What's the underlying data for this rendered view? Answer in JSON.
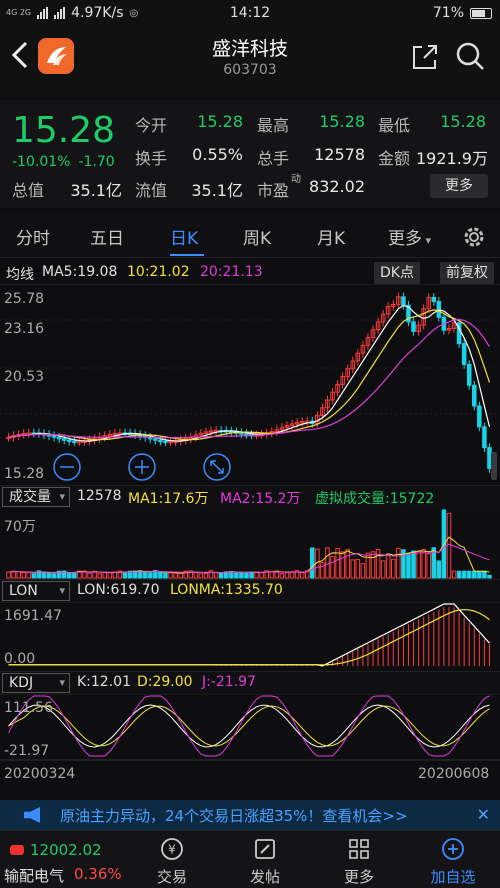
{
  "status": {
    "signal": "4G  2G",
    "speed": "4.97K/s",
    "time": "14:12",
    "battery": "71%"
  },
  "header": {
    "title": "盛洋科技",
    "code": "603703"
  },
  "quote": {
    "price": "15.28",
    "change_pct": "-10.01%",
    "change": "-1.70",
    "fields": [
      {
        "label": "今开",
        "value": "15.28",
        "green": true
      },
      {
        "label": "最高",
        "value": "15.28",
        "green": true
      },
      {
        "label": "最低",
        "value": "15.28",
        "green": true
      },
      {
        "label": "换手",
        "value": "0.55%",
        "green": false
      },
      {
        "label": "总手",
        "value": "12578",
        "green": false
      },
      {
        "label": "金额",
        "value": "1921.9万",
        "green": false
      },
      {
        "label": "总值",
        "value": "35.1亿",
        "green": false
      },
      {
        "label": "流值",
        "value": "35.1亿",
        "green": false
      },
      {
        "label": "市盈",
        "value": "832.02",
        "green": false,
        "sup": "动"
      }
    ],
    "more_label": "更多"
  },
  "tabs": [
    "分时",
    "五日",
    "日K",
    "周K",
    "月K",
    "更多"
  ],
  "active_tab": "日K",
  "ma": {
    "label": "均线",
    "ma5": "MA5:19.08",
    "ma10": "10:21.02",
    "ma20": "20:21.13",
    "dk_btn": "DK点",
    "adj_btn": "前复权"
  },
  "price_axis": {
    "top": "25.78",
    "mid1": "23.16",
    "mid2": "20.53",
    "bottom": "15.28"
  },
  "volume": {
    "selector": "成交量",
    "vol": "12578",
    "ma1": "MA1:17.6万",
    "ma2": "MA2:15.2万",
    "virtual": "虚拟成交量:15722",
    "axis_top": "70万"
  },
  "lon": {
    "selector": "LON",
    "lon": "LON:619.70",
    "lonma": "LONMA:1335.70",
    "axis_top": "1691.47",
    "axis_bottom": "0.00"
  },
  "kdj": {
    "selector": "KDJ",
    "k": "K:12.01",
    "d": "D:29.00",
    "j": "J:-21.97",
    "axis_top": "111.56",
    "axis_bottom": "-21.97"
  },
  "dates": {
    "start": "20200324",
    "end": "20200608"
  },
  "banner": {
    "text": "原油主力异动，24个交易日涨超35%！查看机会>>"
  },
  "bottom": {
    "index_value": "12002.02",
    "index_name": "输配电气",
    "index_pct": "0.36%",
    "nav": [
      {
        "label": "交易",
        "icon": "trade-icon"
      },
      {
        "label": "发帖",
        "icon": "post-icon"
      },
      {
        "label": "更多",
        "icon": "grid-icon"
      },
      {
        "label": "加自选",
        "icon": "add-icon"
      }
    ]
  },
  "colors": {
    "up": "#ff3b3b",
    "down": "#1fcb68",
    "cyan": "#19d3e8",
    "accent": "#3c8cff",
    "yellow": "#f2e23a",
    "magenta": "#e23bdc"
  }
}
